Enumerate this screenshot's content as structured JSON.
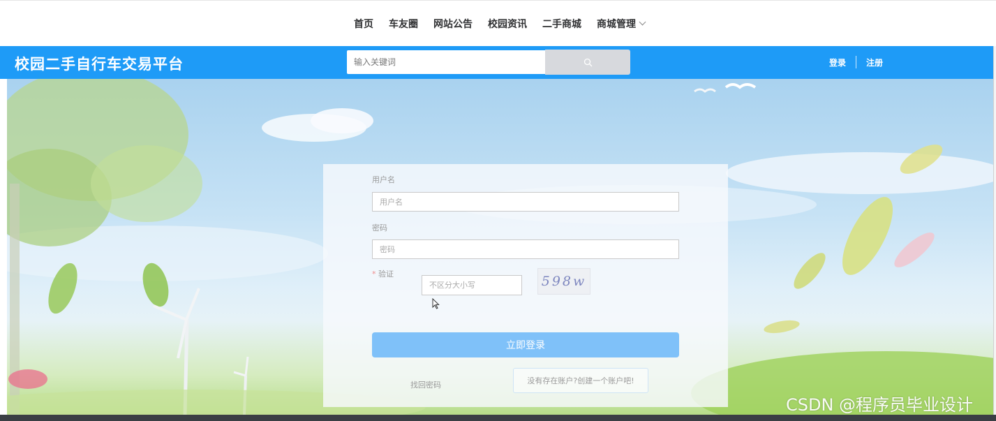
{
  "nav": {
    "items": [
      "首页",
      "车友圈",
      "网站公告",
      "校园资讯",
      "二手商城",
      "商城管理"
    ]
  },
  "header": {
    "title": "校园二手自行车交易平台",
    "search_placeholder": "输入关键词",
    "login": "登录",
    "register": "注册"
  },
  "login_form": {
    "username_label": "用户名",
    "username_placeholder": "用户名",
    "password_label": "密码",
    "password_placeholder": "密码",
    "captcha_required": "*",
    "captcha_label": "验证",
    "captcha_placeholder": "不区分大小写",
    "captcha_text": "598w",
    "submit": "立即登录",
    "forgot": "找回密码",
    "create_account": "没有存在账户?创建一个账户吧!"
  },
  "watermark": "CSDN @程序员毕业设计",
  "colors": {
    "accent": "#1e9bf7",
    "button": "#7fc1f9"
  }
}
